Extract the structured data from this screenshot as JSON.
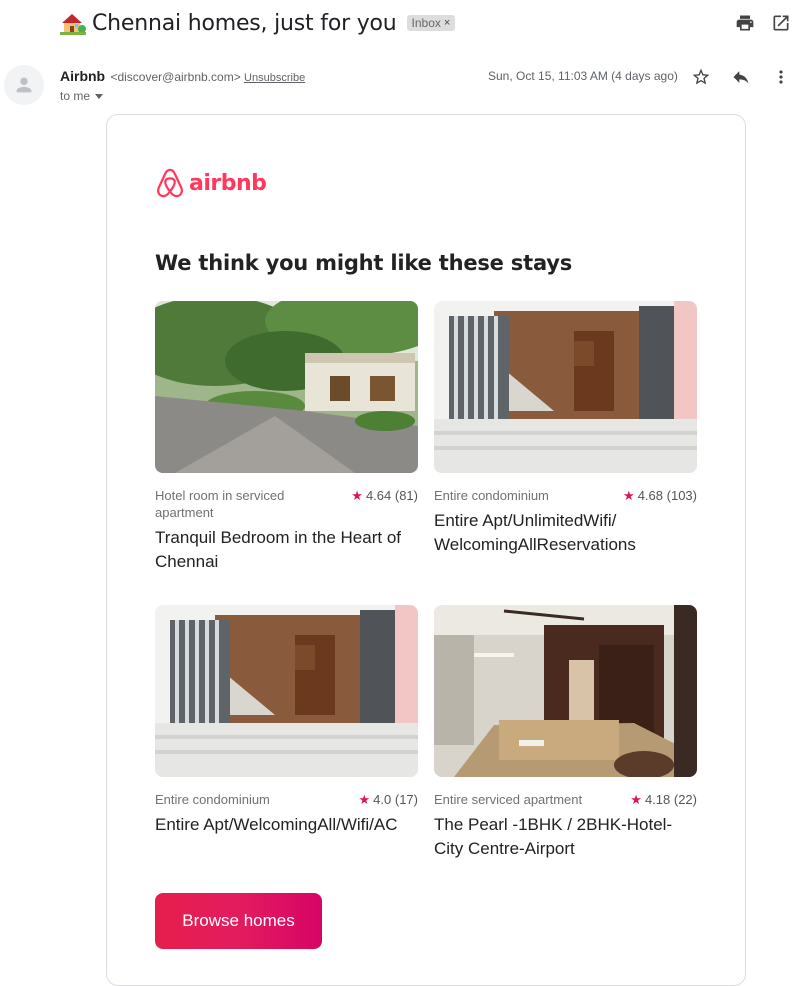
{
  "subject": "Chennai homes, just for you",
  "label_chip": "Inbox",
  "label_chip_close": "×",
  "icons": {
    "house": "house-with-garden-icon",
    "print": "printer-icon",
    "popout": "open-in-new-window-icon",
    "star": "star-outline-icon",
    "reply": "reply-icon",
    "more": "more-vert-icon"
  },
  "sender": {
    "name": "Airbnb",
    "email": "<discover@airbnb.com>",
    "unsubscribe": "Unsubscribe",
    "to": "to me",
    "date": "Sun, Oct 15, 11:03 AM (4 days ago)"
  },
  "email": {
    "brand": "airbnb",
    "brand_color": "#ff385c",
    "headline": "We think you might like these stays",
    "listings": [
      {
        "type": "Hotel room in serviced apartment",
        "rating": "4.64",
        "reviews": "(81)",
        "title": "Tranquil Bedroom in the Heart of Chennai"
      },
      {
        "type": "Entire condominium",
        "rating": "4.68",
        "reviews": "(103)",
        "title": "Entire Apt/UnlimitedWifi/ WelcomingAllReservations"
      },
      {
        "type": "Entire condominium",
        "rating": "4.0",
        "reviews": "(17)",
        "title": "Entire Apt/WelcomingAll/Wifi/AC"
      },
      {
        "type": "Entire serviced apartment",
        "rating": "4.18",
        "reviews": "(22)",
        "title": "The Pearl -1BHK / 2BHK-Hotel-City Centre-Airport"
      }
    ],
    "cta": "Browse homes",
    "star_color": "#e0115f"
  }
}
